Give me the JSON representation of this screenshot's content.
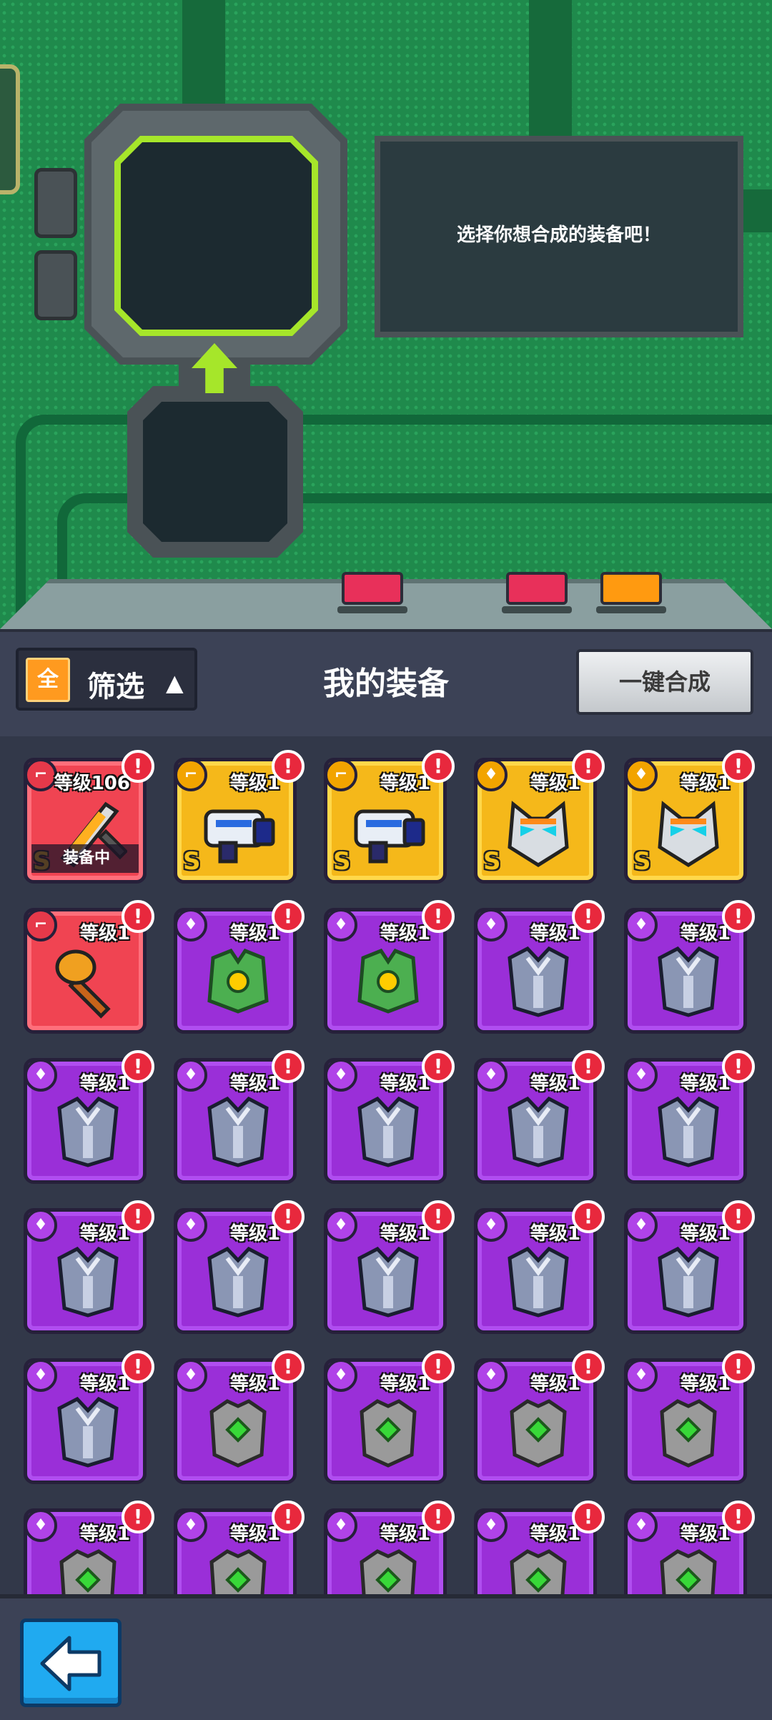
{
  "hint": {
    "text": "选择你想合成的装备吧！"
  },
  "toolbar": {
    "filter_all": "全",
    "filter_label": "筛选",
    "filter_caret": "▲",
    "title": "我的装备",
    "merge_all": "一键合成"
  },
  "inventory": {
    "alert_mark": "!",
    "items": [
      {
        "rarity": "red",
        "type": "weapon",
        "art": "sword",
        "level": "等级106",
        "grade": "S",
        "status": "装备中"
      },
      {
        "rarity": "yellow",
        "type": "weapon",
        "art": "blaster",
        "level": "等级1",
        "grade": "S"
      },
      {
        "rarity": "yellow",
        "type": "weapon",
        "art": "blaster",
        "level": "等级1",
        "grade": "S"
      },
      {
        "rarity": "yellow",
        "type": "armor",
        "art": "robot-helmet",
        "level": "等级1",
        "grade": "S"
      },
      {
        "rarity": "yellow",
        "type": "armor",
        "art": "robot-helmet",
        "level": "等级1",
        "grade": "S"
      },
      {
        "rarity": "red",
        "type": "weapon",
        "art": "hammer",
        "level": "等级1"
      },
      {
        "rarity": "purple",
        "type": "armor",
        "art": "green-vest",
        "level": "等级1"
      },
      {
        "rarity": "purple",
        "type": "armor",
        "art": "green-vest",
        "level": "等级1"
      },
      {
        "rarity": "purple",
        "type": "armor",
        "art": "steel-armor",
        "level": "等级1"
      },
      {
        "rarity": "purple",
        "type": "armor",
        "art": "steel-armor",
        "level": "等级1"
      },
      {
        "rarity": "purple",
        "type": "armor",
        "art": "steel-armor",
        "level": "等级1"
      },
      {
        "rarity": "purple",
        "type": "armor",
        "art": "steel-armor",
        "level": "等级1"
      },
      {
        "rarity": "purple",
        "type": "armor",
        "art": "steel-armor",
        "level": "等级1"
      },
      {
        "rarity": "purple",
        "type": "armor",
        "art": "steel-armor",
        "level": "等级1"
      },
      {
        "rarity": "purple",
        "type": "armor",
        "art": "steel-armor",
        "level": "等级1"
      },
      {
        "rarity": "purple",
        "type": "armor",
        "art": "steel-armor",
        "level": "等级1"
      },
      {
        "rarity": "purple",
        "type": "armor",
        "art": "steel-armor",
        "level": "等级1"
      },
      {
        "rarity": "purple",
        "type": "armor",
        "art": "steel-armor",
        "level": "等级1"
      },
      {
        "rarity": "purple",
        "type": "armor",
        "art": "steel-armor",
        "level": "等级1"
      },
      {
        "rarity": "purple",
        "type": "armor",
        "art": "steel-armor",
        "level": "等级1"
      },
      {
        "rarity": "purple",
        "type": "armor",
        "art": "steel-armor",
        "level": "等级1"
      },
      {
        "rarity": "purple",
        "type": "armor",
        "art": "stone-armor",
        "level": "等级1"
      },
      {
        "rarity": "purple",
        "type": "armor",
        "art": "stone-armor",
        "level": "等级1"
      },
      {
        "rarity": "purple",
        "type": "armor",
        "art": "stone-armor",
        "level": "等级1"
      },
      {
        "rarity": "purple",
        "type": "armor",
        "art": "stone-armor",
        "level": "等级1"
      },
      {
        "rarity": "purple",
        "type": "armor",
        "art": "stone-armor",
        "level": "等级1"
      },
      {
        "rarity": "purple",
        "type": "armor",
        "art": "stone-armor",
        "level": "等级1"
      },
      {
        "rarity": "purple",
        "type": "armor",
        "art": "stone-armor",
        "level": "等级1"
      },
      {
        "rarity": "purple",
        "type": "armor",
        "art": "stone-armor",
        "level": "等级1"
      },
      {
        "rarity": "purple",
        "type": "armor",
        "art": "stone-armor",
        "level": "等级1"
      }
    ]
  },
  "colors": {
    "background_green": "#1f8a4c",
    "slot_accent": "#a6e62a",
    "press_buttons": [
      "#e8305a",
      "#e8305a",
      "#ff9a10"
    ],
    "rarity": {
      "red": "#f04452",
      "yellow": "#f5b81a",
      "purple": "#9a2fd8"
    }
  },
  "icons": {
    "back": "back-arrow-icon",
    "weapon": "gun-icon",
    "armor": "shirt-icon"
  }
}
